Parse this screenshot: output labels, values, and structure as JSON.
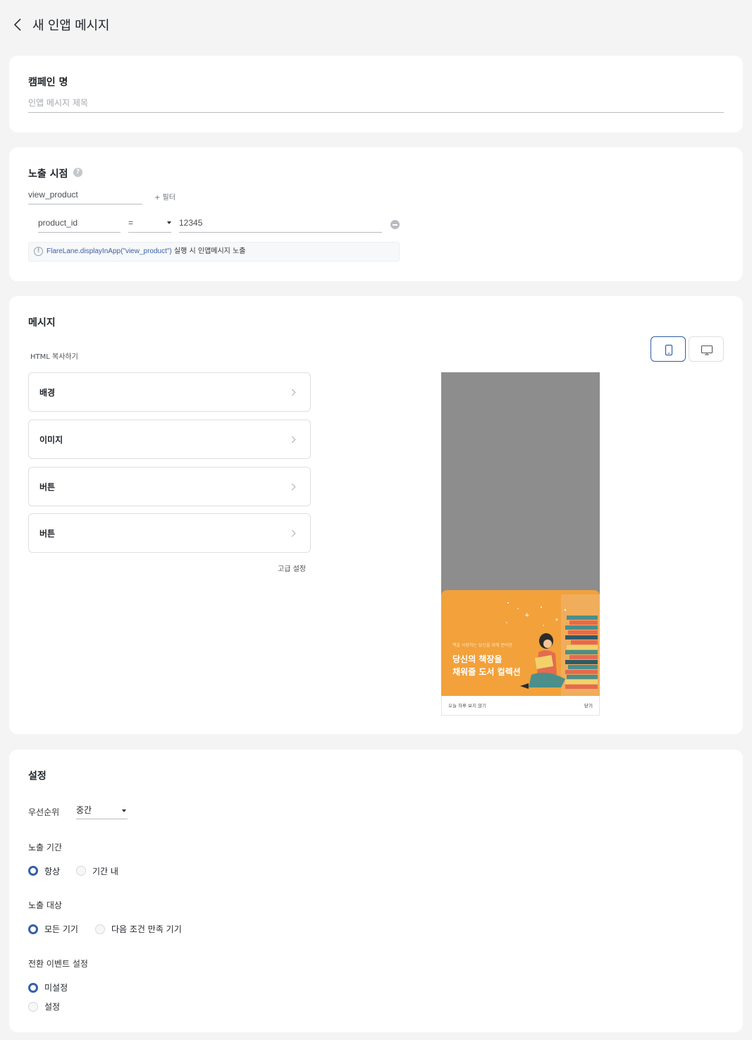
{
  "header": {
    "title": "새 인앱 메시지"
  },
  "campaign": {
    "title": "캠페인 명",
    "placeholder": "인앱 메시지 제목",
    "value": ""
  },
  "trigger": {
    "title": "노출 시점",
    "event": "view_product",
    "add_filter": "+ 필터",
    "filter": {
      "key": "product_id",
      "operator": "=",
      "value": "12345"
    },
    "hint_code": "FlareLane.displayInApp(\"view_product\")",
    "hint_text": " 실행 시 인앱메시지 노출"
  },
  "message": {
    "title": "메시지",
    "copy_html": "HTML 복사하기",
    "sections": [
      {
        "label": "배경"
      },
      {
        "label": "이미지"
      },
      {
        "label": "버튼"
      },
      {
        "label": "버튼"
      }
    ],
    "advanced": "고급 설정",
    "preview": {
      "subtitle": "책을 사랑하는 당신을 위해 준비한",
      "headline_line1": "당신의 책장을",
      "headline_line2": "채워줄 도서 컬렉션",
      "dont_show_today": "오늘 하루 보지 않기",
      "close": "닫기"
    }
  },
  "settings": {
    "title": "설정",
    "priority": {
      "label": "우선순위",
      "value": "중간"
    },
    "period": {
      "label": "노출 기간",
      "options": [
        "항상",
        "기간 내"
      ],
      "selected": 0
    },
    "target": {
      "label": "노출 대상",
      "options": [
        "모든 기기",
        "다음 조건 만족 기기"
      ],
      "selected": 0
    },
    "conversion": {
      "label": "전환 이벤트 설정",
      "options": [
        "미설정",
        "설정"
      ],
      "selected": 0
    }
  },
  "colors": {
    "accent": "#3560a8",
    "banner": "#f2a13b",
    "preview_backdrop": "#8d8d8d",
    "page_bg": "#f4f4f5"
  }
}
